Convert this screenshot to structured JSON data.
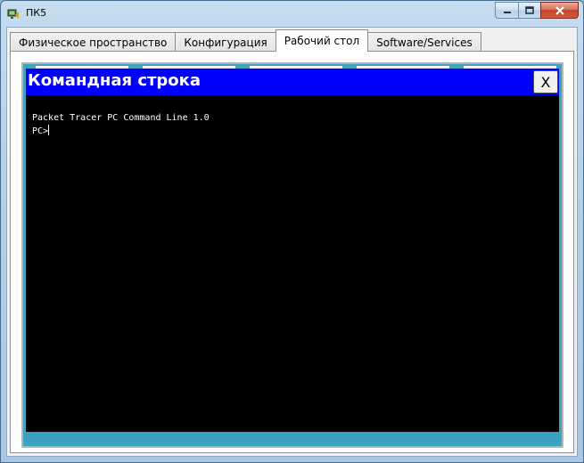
{
  "window": {
    "title": "ПК5",
    "minimize_symbol": "—",
    "maximize_symbol": "□",
    "close_symbol": "✕"
  },
  "tabs": [
    {
      "label": "Физическое пространство",
      "active": false
    },
    {
      "label": "Конфигурация",
      "active": false
    },
    {
      "label": "Рабочий стол",
      "active": true
    },
    {
      "label": "Software/Services",
      "active": false
    }
  ],
  "command_prompt": {
    "title": "Командная строка",
    "close_label": "X",
    "lines": [
      "Packet Tracer PC Command Line 1.0",
      "PC>"
    ]
  },
  "colors": {
    "header_blue": "#0000ff",
    "terminal_bg": "#000000",
    "desktop_teal": "#3fa3c0"
  }
}
